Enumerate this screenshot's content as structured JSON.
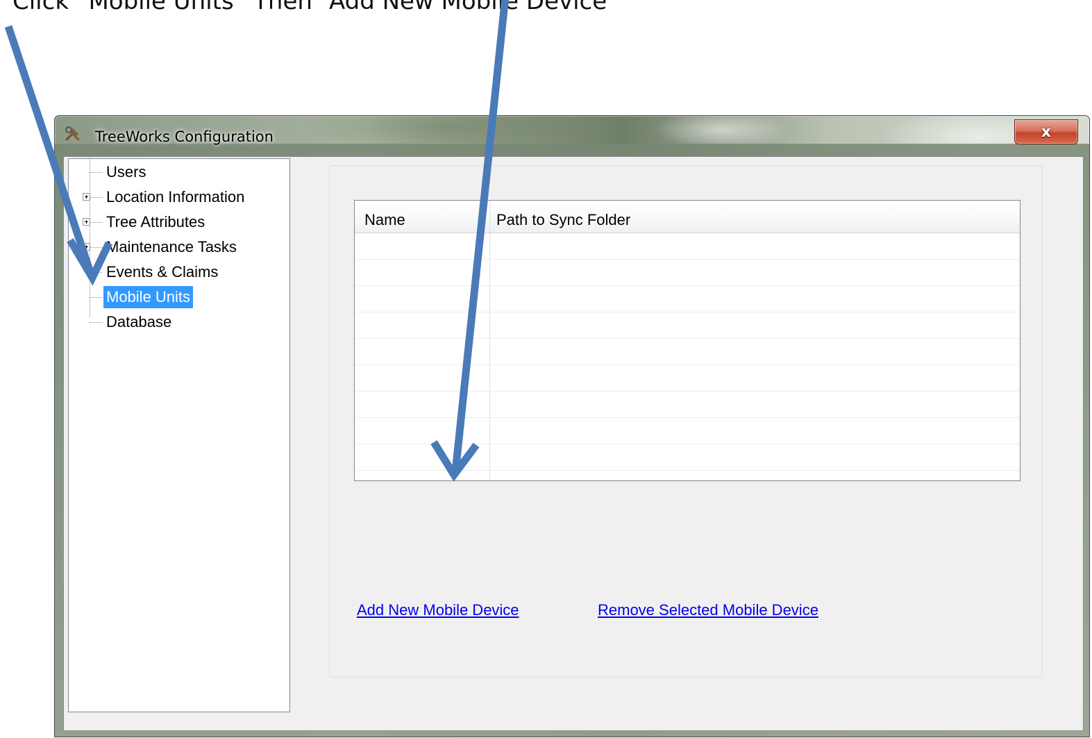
{
  "instruction": "Click “Mobile Units” Then “Add New Mobile Device”",
  "window": {
    "title": "TreeWorks Configuration",
    "close_label": "x"
  },
  "tree": {
    "items": [
      {
        "label": "Users",
        "expandable": false
      },
      {
        "label": "Location Information",
        "expandable": true
      },
      {
        "label": "Tree Attributes",
        "expandable": true
      },
      {
        "label": "Maintenance Tasks",
        "expandable": true
      },
      {
        "label": "Events & Claims",
        "expandable": false
      },
      {
        "label": "Mobile Units",
        "expandable": false,
        "selected": true
      },
      {
        "label": "Database",
        "expandable": false
      }
    ]
  },
  "grid": {
    "columns": [
      "Name",
      "Path to Sync Folder"
    ],
    "rows": []
  },
  "links": {
    "add": "Add New Mobile Device",
    "remove": "Remove Selected Mobile Device"
  },
  "colors": {
    "selection": "#3399ff",
    "arrow": "#4a7ab8",
    "link": "#0000ee"
  }
}
